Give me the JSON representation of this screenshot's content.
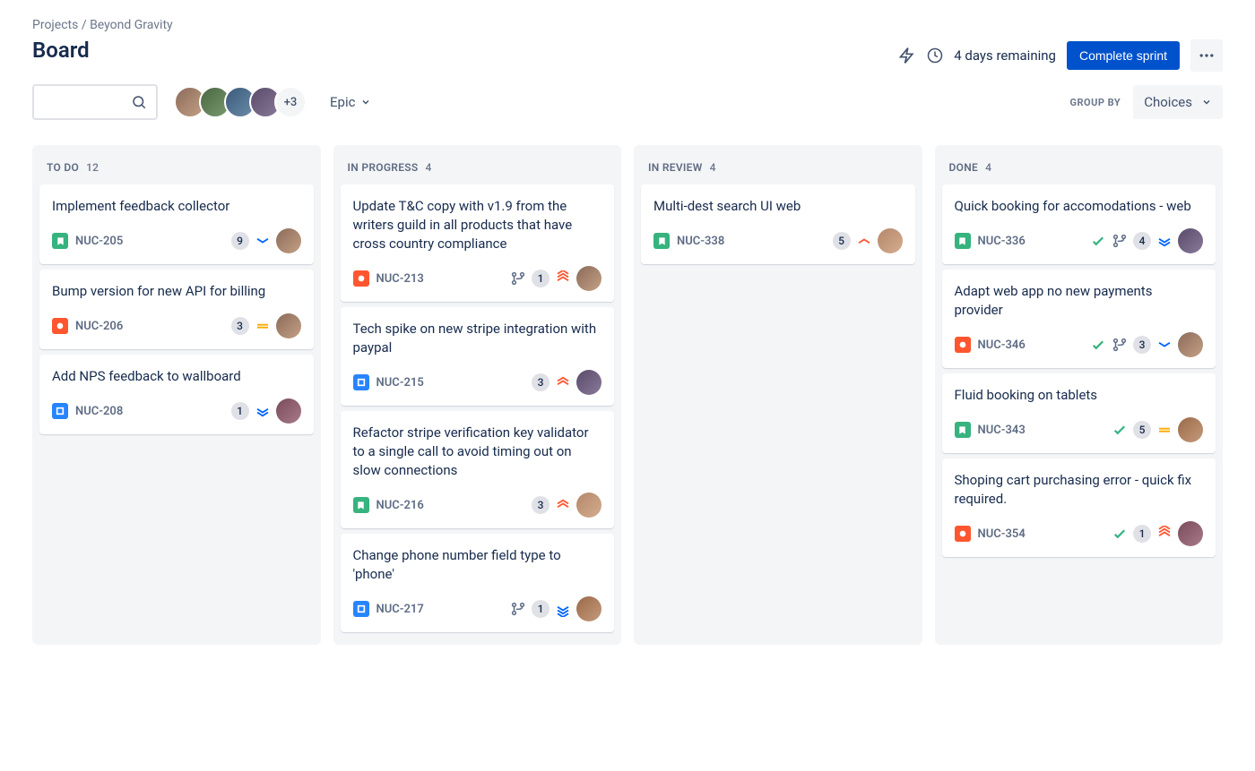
{
  "breadcrumb": {
    "projects": "Projects",
    "project_name": "Beyond Gravity"
  },
  "page_title": "Board",
  "header": {
    "days_remaining": "4 days remaining",
    "complete_sprint": "Complete sprint"
  },
  "controls": {
    "epic_label": "Epic",
    "avatar_more": "+3",
    "groupby_label": "GROUP BY",
    "choices_label": "Choices"
  },
  "columns": [
    {
      "title": "TO DO",
      "count": "12",
      "cards": [
        {
          "title": "Implement feedback collector",
          "type": "story",
          "key": "NUC-205",
          "count": "9",
          "priority": "low",
          "avatar": "av-a"
        },
        {
          "title": "Bump version for new API for billing",
          "type": "bug",
          "key": "NUC-206",
          "count": "3",
          "priority": "medium",
          "avatar": "av-a"
        },
        {
          "title": "Add NPS feedback to wallboard",
          "type": "task",
          "key": "NUC-208",
          "count": "1",
          "priority": "lowest",
          "avatar": "av-f"
        }
      ]
    },
    {
      "title": "IN PROGRESS",
      "count": "4",
      "cards": [
        {
          "title": "Update T&C copy with v1.9 from the writers guild in all products that have cross country compliance",
          "type": "bug",
          "key": "NUC-213",
          "branch": true,
          "count": "1",
          "priority": "highest",
          "avatar": "av-a"
        },
        {
          "title": "Tech spike on new stripe integration with paypal",
          "type": "task",
          "key": "NUC-215",
          "count": "3",
          "priority": "high",
          "avatar": "av-d"
        },
        {
          "title": "Refactor stripe verification key validator to a single call to avoid timing out on slow connections",
          "type": "story",
          "key": "NUC-216",
          "count": "3",
          "priority": "high",
          "avatar": "av-e"
        },
        {
          "title": "Change phone number field type to 'phone'",
          "type": "task",
          "key": "NUC-217",
          "branch": true,
          "count": "1",
          "priority": "lowest-blue",
          "avatar": "av-g"
        }
      ]
    },
    {
      "title": "IN REVIEW",
      "count": "4",
      "cards": [
        {
          "title": "Multi-dest search UI web",
          "type": "story",
          "key": "NUC-338",
          "count": "5",
          "priority": "high-single",
          "avatar": "av-e"
        }
      ]
    },
    {
      "title": "DONE",
      "count": "4",
      "cards": [
        {
          "title": "Quick booking for accomodations - web",
          "type": "story",
          "key": "NUC-336",
          "check": true,
          "branch": true,
          "count": "4",
          "priority": "lowest",
          "avatar": "av-d"
        },
        {
          "title": "Adapt web app no new payments provider",
          "type": "bug",
          "key": "NUC-346",
          "check": true,
          "branch": true,
          "count": "3",
          "priority": "low",
          "avatar": "av-a"
        },
        {
          "title": "Fluid booking on tablets",
          "type": "story",
          "key": "NUC-343",
          "check": true,
          "count": "5",
          "priority": "medium",
          "avatar": "av-g"
        },
        {
          "title": "Shoping cart purchasing error - quick fix required.",
          "type": "bug",
          "key": "NUC-354",
          "check": true,
          "count": "1",
          "priority": "highest",
          "avatar": "av-f"
        }
      ]
    }
  ]
}
